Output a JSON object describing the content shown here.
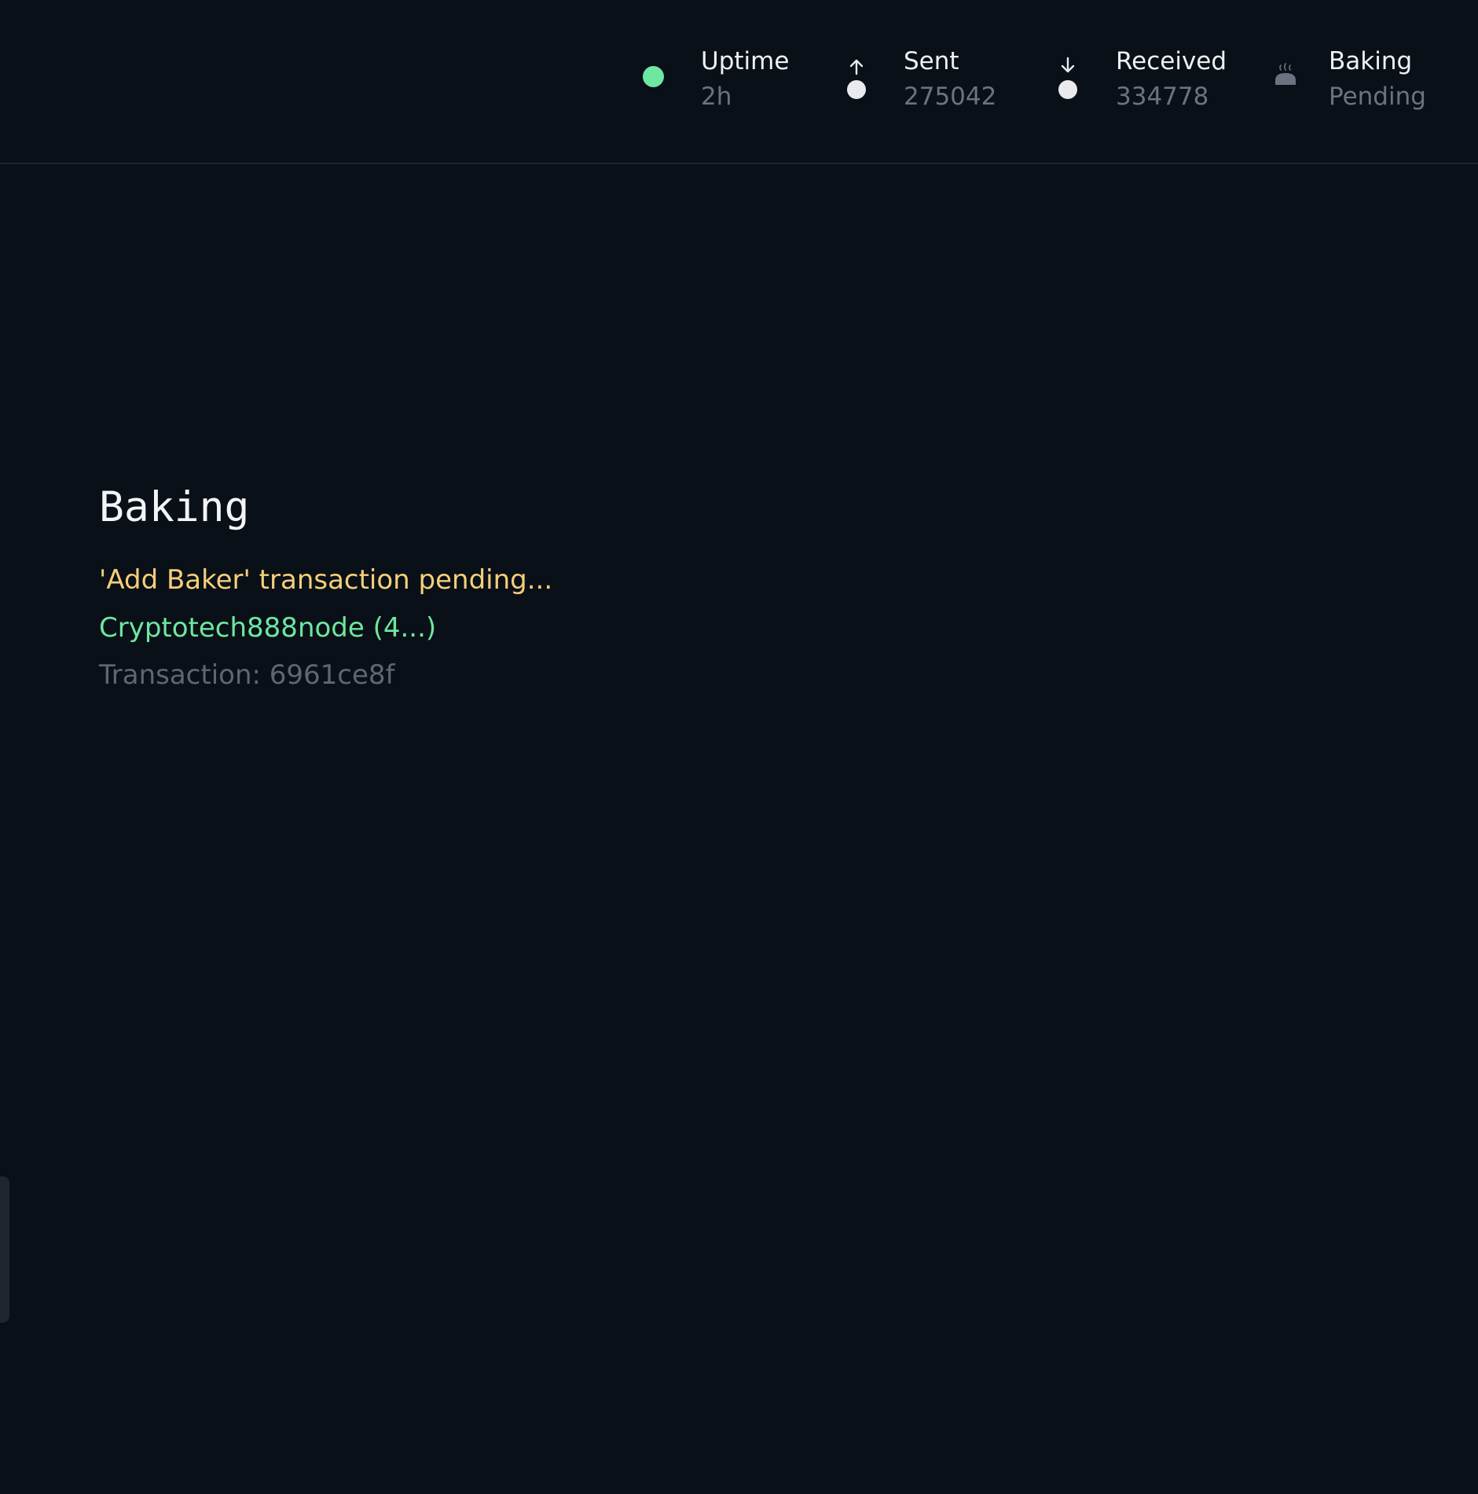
{
  "header": {
    "stats": [
      {
        "id": "uptime",
        "label": "Uptime",
        "value": "2h",
        "icon": "status-dot-icon",
        "color": "#6ee7a0"
      },
      {
        "id": "sent",
        "label": "Sent",
        "value": "275042",
        "icon": "arrow-up-icon"
      },
      {
        "id": "received",
        "label": "Received",
        "value": "334778",
        "icon": "arrow-down-icon"
      },
      {
        "id": "baking",
        "label": "Baking",
        "value": "Pending",
        "icon": "bread-icon"
      }
    ]
  },
  "main": {
    "title": "Baking",
    "pending_message": "'Add Baker' transaction pending...",
    "node_name": "Cryptotech888node (4...)",
    "transaction": "Transaction: 6961ce8f"
  },
  "colors": {
    "background": "#0a1017",
    "accent_green": "#6ee7a0",
    "warning_yellow": "#f5cf7a",
    "muted_text": "#5f6673"
  }
}
